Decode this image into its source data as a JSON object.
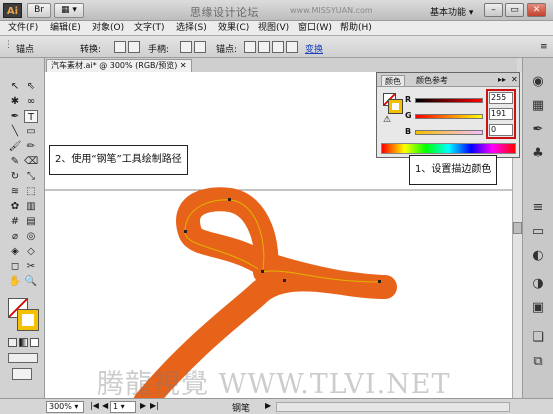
{
  "titlebar": {
    "app_logo": "Ai",
    "window_title": "思缘设计论坛",
    "site": "www.MISSYUAN.com",
    "workspace": "基本功能"
  },
  "menubar": {
    "items": [
      "文件(F)",
      "编辑(E)",
      "对象(O)",
      "文字(T)",
      "选择(S)",
      "效果(C)",
      "视图(V)",
      "窗口(W)",
      "帮助(H)"
    ]
  },
  "controlbar": {
    "mode": "锚点",
    "convert_label": "转换:",
    "handles_label": "手柄:",
    "anchors_label": "锚点:",
    "transform_link": "变换"
  },
  "document_tab": {
    "label": "汽车素材.ai* @ 300% (RGB/预览)"
  },
  "color_panel": {
    "tabs": [
      "颜色",
      "颜色参考"
    ],
    "channels": [
      {
        "label": "R",
        "value": "255"
      },
      {
        "label": "G",
        "value": "191"
      },
      {
        "label": "B",
        "value": "0"
      }
    ],
    "highlight_color": "#cc1111"
  },
  "callouts": {
    "step1": "1、设置描边颜色",
    "step2": "2、使用“钢笔”工具绘制路径"
  },
  "canvas": {
    "stroke_color": "#e8631a",
    "path_color": "#e0b400"
  },
  "watermark": "腾龍視覺 WWW.TLVI.NET",
  "statusbar": {
    "zoom": "300%",
    "page": "1",
    "tool_name": "钢笔"
  }
}
